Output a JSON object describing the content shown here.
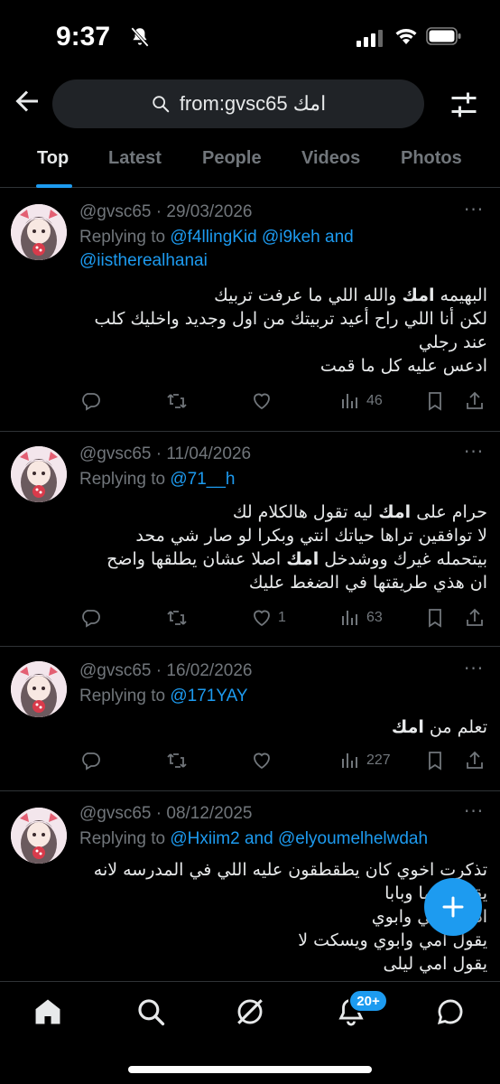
{
  "status_bar": {
    "time": "9:37"
  },
  "search": {
    "query": "from:gvsc65 امك"
  },
  "tabs": [
    {
      "label": "Top"
    },
    {
      "label": "Latest"
    },
    {
      "label": "People"
    },
    {
      "label": "Videos"
    },
    {
      "label": "Photos"
    }
  ],
  "tweets": [
    {
      "handle": "@gvsc65",
      "date": "29/03/2026",
      "replying_prefix": "Replying to",
      "replying_to": "@f4llingKid @i9keh and @iistherealhanai",
      "lines": [
        "البهيمه امك والله اللي ما عرفت تربيك",
        "لكن أنا اللي راح أعيد تربيتك من اول وجديد واخليك كلب",
        "عند رجلي",
        "ادعس عليه كل ما قمت"
      ],
      "replies": "",
      "retweets": "",
      "likes": "",
      "views": "46"
    },
    {
      "handle": "@gvsc65",
      "date": "11/04/2026",
      "replying_prefix": "Replying to",
      "replying_to": "@71__h",
      "lines": [
        "حرام على امك ليه تقول هالكلام لك",
        "لا توافقين تراها حياتك انتي وبكرا لو صار شي محد",
        "بيتحمله غيرك ووشدخل امك اصلا عشان يطلقها واضح",
        "ان هذي طريقتها في الضغط عليك"
      ],
      "replies": "",
      "retweets": "",
      "likes": "1",
      "views": "63"
    },
    {
      "handle": "@gvsc65",
      "date": "16/02/2026",
      "replying_prefix": "Replying to",
      "replying_to": "@171YAY",
      "lines": [
        "تعلم من امك"
      ],
      "replies": "",
      "retweets": "",
      "likes": "",
      "views": "227"
    },
    {
      "handle": "@gvsc65",
      "date": "08/12/2025",
      "replying_prefix": "Replying to",
      "replying_to": "@Hxiim2 and @elyoumelhelwdah",
      "lines": [
        "تذكرت اخوي كان يطقطقون عليه اللي في المدرسه لانه",
        "يقول ماما وبابا",
        "اديهم امي وابوي",
        "يقول امي وابوي ويسكت لا",
        "يقول امي ليلى"
      ]
    }
  ],
  "notifications_badge": "20+",
  "colors": {
    "accent": "#1d9bf0",
    "background": "#000000",
    "muted": "#71767b",
    "text": "#e7e9ea"
  },
  "icons": [
    "back-arrow-icon",
    "search-icon",
    "filter-icon",
    "more-icon",
    "reply-icon",
    "retweet-icon",
    "like-icon",
    "views-icon",
    "bookmark-icon",
    "share-icon",
    "compose-icon",
    "home-icon",
    "explore-icon",
    "grok-icon",
    "notifications-icon",
    "messages-icon"
  ]
}
